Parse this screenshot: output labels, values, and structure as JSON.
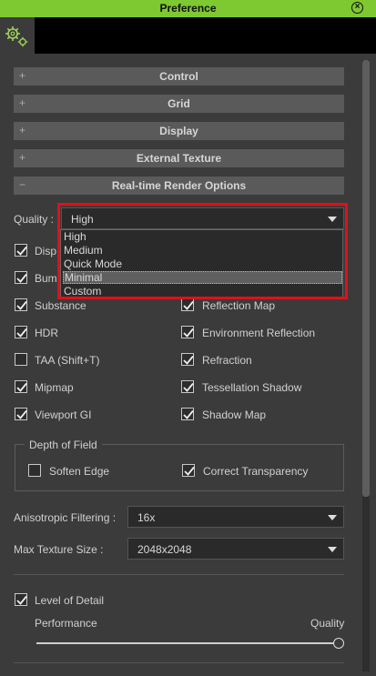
{
  "window": {
    "title": "Preference"
  },
  "sections": [
    {
      "label": "Control",
      "sign": "+"
    },
    {
      "label": "Grid",
      "sign": "+"
    },
    {
      "label": "Display",
      "sign": "+"
    },
    {
      "label": "External Texture",
      "sign": "+"
    },
    {
      "label": "Real-time Render Options",
      "sign": "−"
    }
  ],
  "quality": {
    "label": "Quality :",
    "value": "High",
    "options": [
      "High",
      "Medium",
      "Quick Mode",
      "Minimal",
      "Custom"
    ],
    "highlighted": "Minimal"
  },
  "left_checks": [
    {
      "label": "Disp",
      "checked": true
    },
    {
      "label": "Bum",
      "checked": true
    },
    {
      "label": "Substance",
      "checked": true
    },
    {
      "label": "HDR",
      "checked": true
    },
    {
      "label": "TAA (Shift+T)",
      "checked": false
    },
    {
      "label": "Mipmap",
      "checked": true
    },
    {
      "label": "Viewport GI",
      "checked": true
    }
  ],
  "right_checks": [
    {
      "label": "Reflection Map",
      "checked": true
    },
    {
      "label": "Environment Reflection",
      "checked": true
    },
    {
      "label": "Refraction",
      "checked": true
    },
    {
      "label": "Tessellation Shadow",
      "checked": true
    },
    {
      "label": "Shadow Map",
      "checked": true
    }
  ],
  "depth_of_field": {
    "title": "Depth of Field",
    "soft_edge": {
      "label": "Soften Edge",
      "checked": false
    },
    "correct_transparency": {
      "label": "Correct Transparency",
      "checked": true
    }
  },
  "anisotropic": {
    "label": "Anisotropic Filtering :",
    "value": "16x"
  },
  "max_texture": {
    "label": "Max Texture Size :",
    "value": "2048x2048"
  },
  "level_of_detail": {
    "label": "Level of Detail",
    "checked": true,
    "left_label": "Performance",
    "right_label": "Quality",
    "slider_value": 1.0
  }
}
